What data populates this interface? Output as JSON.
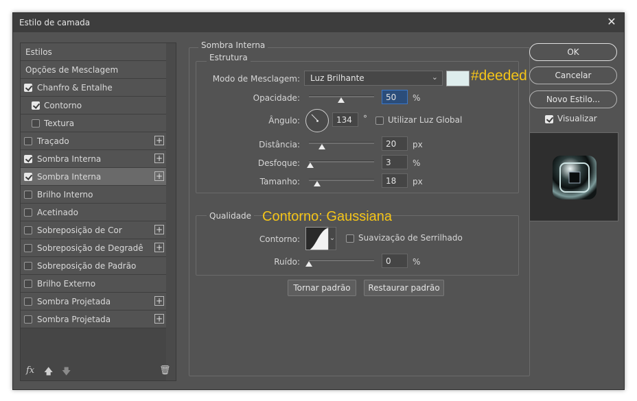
{
  "window": {
    "title": "Estilo de camada",
    "close_icon": "close-icon"
  },
  "left_panel": {
    "items": [
      {
        "label": "Estilos",
        "checkbox": null,
        "plus": false,
        "indent": false,
        "selected": false
      },
      {
        "label": "Opções de Mesclagem",
        "checkbox": null,
        "plus": false,
        "indent": false,
        "selected": false
      },
      {
        "label": "Chanfro & Entalhe",
        "checkbox": true,
        "plus": false,
        "indent": false,
        "selected": false
      },
      {
        "label": "Contorno",
        "checkbox": true,
        "plus": false,
        "indent": true,
        "selected": false
      },
      {
        "label": "Textura",
        "checkbox": false,
        "plus": false,
        "indent": true,
        "selected": false
      },
      {
        "label": "Traçado",
        "checkbox": false,
        "plus": true,
        "indent": false,
        "selected": false
      },
      {
        "label": "Sombra Interna",
        "checkbox": true,
        "plus": true,
        "indent": false,
        "selected": false
      },
      {
        "label": "Sombra Interna",
        "checkbox": true,
        "plus": true,
        "indent": false,
        "selected": true
      },
      {
        "label": "Brilho Interno",
        "checkbox": false,
        "plus": false,
        "indent": false,
        "selected": false
      },
      {
        "label": "Acetinado",
        "checkbox": false,
        "plus": false,
        "indent": false,
        "selected": false
      },
      {
        "label": "Sobreposição de Cor",
        "checkbox": false,
        "plus": true,
        "indent": false,
        "selected": false
      },
      {
        "label": "Sobreposição de Degradê",
        "checkbox": false,
        "plus": true,
        "indent": false,
        "selected": false
      },
      {
        "label": "Sobreposição de Padrão",
        "checkbox": false,
        "plus": false,
        "indent": false,
        "selected": false
      },
      {
        "label": "Brilho Externo",
        "checkbox": false,
        "plus": false,
        "indent": false,
        "selected": false
      },
      {
        "label": "Sombra Projetada",
        "checkbox": false,
        "plus": true,
        "indent": false,
        "selected": false
      },
      {
        "label": "Sombra Projetada",
        "checkbox": false,
        "plus": true,
        "indent": false,
        "selected": false
      }
    ],
    "footer": {
      "fx": "fx",
      "up": "🡅",
      "down": "🡇",
      "trash": "🗑"
    }
  },
  "panel": {
    "title": "Sombra Interna",
    "estrutura": {
      "title": "Estrutura",
      "blend_label": "Modo de Mesclagem:",
      "blend_value": "Luz Brilhante",
      "swatch_color": "#deeded",
      "color_annotation": "#deeded",
      "opacity_label": "Opacidade:",
      "opacity_value": "50",
      "opacity_unit": "%",
      "opacity_level": 50,
      "angle_label": "Ângulo:",
      "angle_value": "134",
      "angle_unit": "°",
      "global_light_label": "Utilizar Luz Global",
      "global_light_checked": false,
      "distance_label": "Distância:",
      "distance_value": "20",
      "distance_unit": "px",
      "choke_label": "Desfoque:",
      "choke_value": "3",
      "choke_unit": "%",
      "size_label": "Tamanho:",
      "size_value": "18",
      "size_unit": "px"
    },
    "qualidade": {
      "title": "Qualidade",
      "annotation": "Contorno: Gaussiana",
      "contour_label": "Contorno:",
      "antialias_label": "Suavização de Serrilhado",
      "antialias_checked": false,
      "noise_label": "Ruído:",
      "noise_value": "0",
      "noise_unit": "%"
    },
    "buttons": {
      "make_default": "Tornar padrão",
      "reset_default": "Restaurar padrão"
    }
  },
  "right": {
    "ok": "OK",
    "cancel": "Cancelar",
    "new_style": "Novo Estilo...",
    "preview_label": "Visualizar",
    "preview_checked": true
  },
  "colors": {
    "annotation": "#f5c518",
    "dialog_bg": "#535353",
    "selected_row": "#6a6a6a"
  }
}
